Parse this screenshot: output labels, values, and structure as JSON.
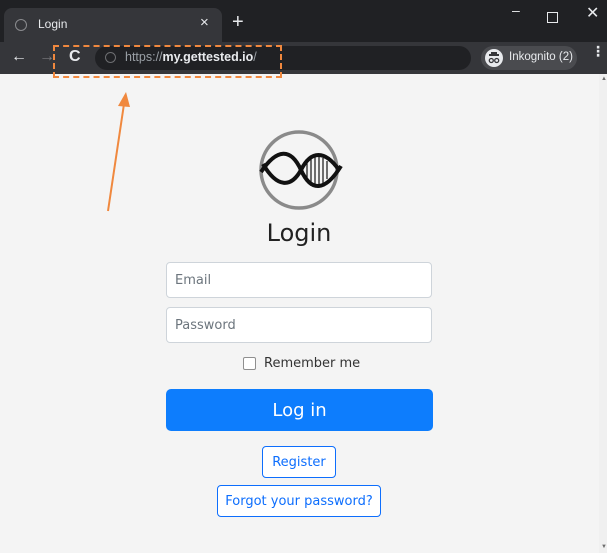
{
  "browser": {
    "tab_title": "Login",
    "tab_close": "×",
    "new_tab": "+",
    "window_min": "–",
    "window_close": "✕",
    "nav_back": "←",
    "nav_forward": "→",
    "nav_reload": "C",
    "url_scheme": "https://",
    "url_host": "my.gettested.io",
    "url_path": "/",
    "incognito_label": "Inkognito (2)",
    "menu": "⋮"
  },
  "icons": {
    "tab_favicon": "loading-favicon-icon",
    "site_info": "site-info-icon",
    "incognito": "incognito-icon",
    "logo": "dna-helix-logo"
  },
  "page": {
    "title": "Login",
    "email_placeholder": "Email",
    "password_placeholder": "Password",
    "remember_label": "Remember me",
    "login_button": "Log in",
    "register_button": "Register",
    "forgot_button": "Forgot your password?"
  },
  "colors": {
    "primary": "#0d7dfd",
    "annotation": "#f0883e",
    "chrome_dark": "#202124",
    "chrome_toolbar": "#35363a"
  }
}
